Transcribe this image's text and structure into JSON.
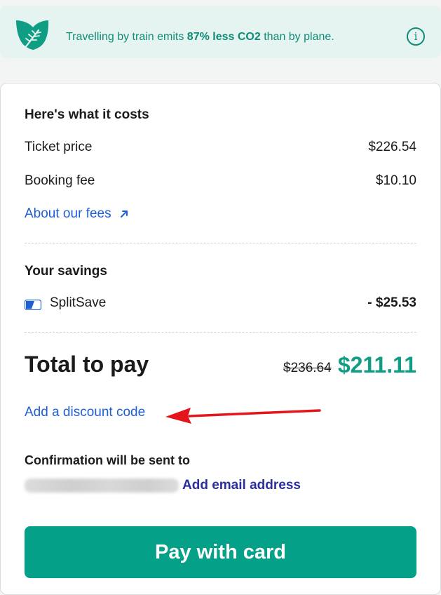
{
  "eco_banner": {
    "text_prefix": "Travelling by train emits ",
    "text_highlight": "87% less CO2",
    "text_suffix": " than by plane.",
    "info_glyph": "i",
    "icon": "leaf-icon",
    "accent_color": "#0f8c78"
  },
  "costs": {
    "heading": "Here's what it costs",
    "lines": [
      {
        "label": "Ticket price",
        "value": "$226.54"
      },
      {
        "label": "Booking fee",
        "value": "$10.10"
      }
    ],
    "about_fees_link": "About our fees",
    "about_fees_icon": "external-arrow-icon"
  },
  "savings": {
    "heading": "Your savings",
    "item_label": "SplitSave",
    "item_value": "- $25.53",
    "item_icon": "splitsave-icon"
  },
  "total": {
    "label": "Total to pay",
    "old_value": "$236.64",
    "new_value": "$211.11",
    "new_value_color": "#0f9d84"
  },
  "discount": {
    "link": "Add a discount code"
  },
  "confirmation": {
    "heading": "Confirmation will be sent to",
    "add_email_link": "Add email address"
  },
  "pay_button": {
    "label": "Pay with card",
    "color": "#04a088"
  }
}
